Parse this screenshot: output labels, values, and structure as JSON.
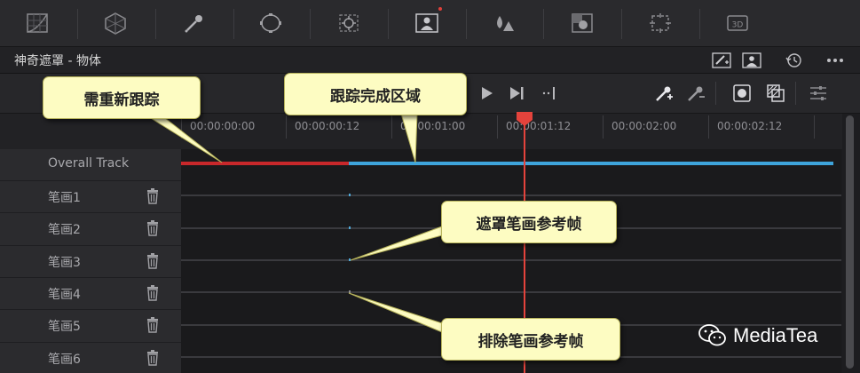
{
  "toolbar": {
    "items": [
      "curves-icon",
      "color-warper-icon",
      "qualifier-eyedropper-icon",
      "power-window-icon",
      "tracker-icon",
      "magic-mask-icon",
      "blur-icon",
      "key-icon",
      "sizing-icon",
      "3d-icon"
    ],
    "icon_3d_label": "3D"
  },
  "panel": {
    "title": "神奇遮罩 - 物体"
  },
  "ruler": {
    "timecodes": [
      "00:00:00:00",
      "00:00:00:12",
      "00:00:01:00",
      "00:00:01:12",
      "00:00:02:00",
      "00:00:02:12"
    ]
  },
  "tracks": {
    "overall_label": "Overall Track",
    "strokes": [
      "笔画1",
      "笔画2",
      "笔画3",
      "笔画4",
      "笔画5",
      "笔画6"
    ]
  },
  "callouts": {
    "retrack": "需重新跟踪",
    "track_done": "跟踪完成区域",
    "mask_stroke_ref": "遮罩笔画参考帧",
    "exclude_stroke_ref": "排除笔画参考帧"
  },
  "watermark": {
    "text": "MediaTea"
  },
  "colors": {
    "playhead": "#e4433c",
    "track_blue": "#3ea4db",
    "track_red": "#c8282b",
    "callout_bg": "#fdfcc2"
  }
}
